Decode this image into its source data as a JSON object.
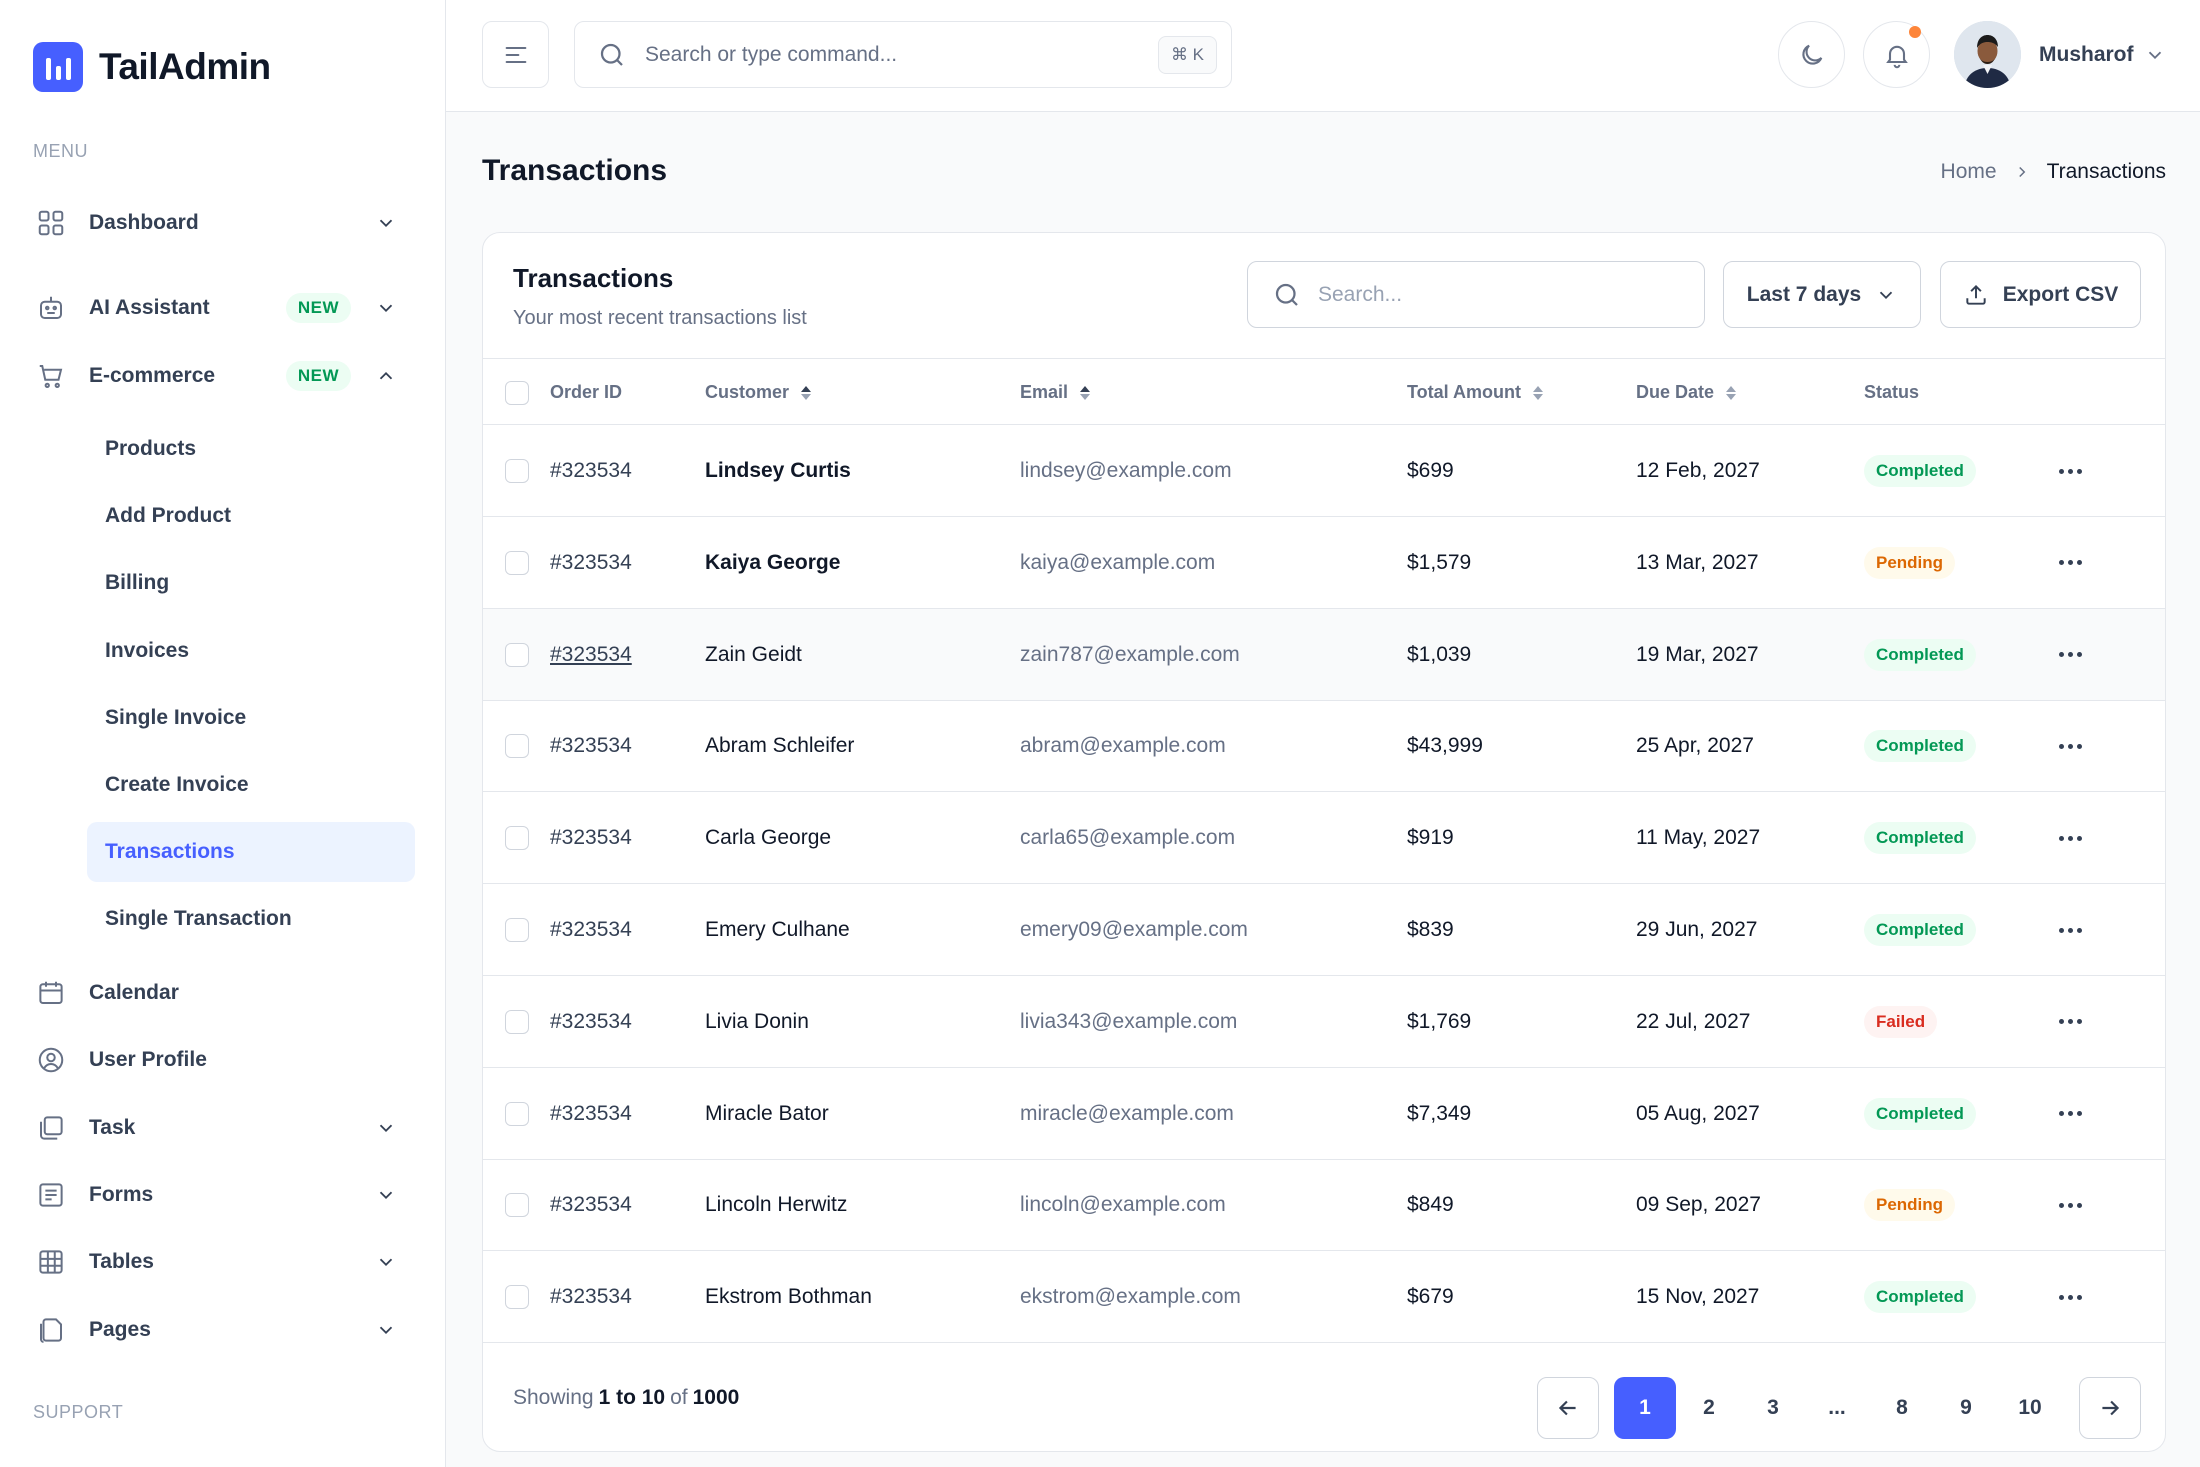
{
  "app": {
    "name": "TailAdmin"
  },
  "sidebar": {
    "menu_label": "MENU",
    "support_label": "SUPPORT",
    "items": [
      {
        "label": "Dashboard",
        "icon": "grid-icon"
      },
      {
        "label": "AI Assistant",
        "icon": "robot-icon",
        "badge": "NEW"
      },
      {
        "label": "E-commerce",
        "icon": "cart-icon",
        "badge": "NEW"
      },
      {
        "label": "Calendar",
        "icon": "calendar-icon"
      },
      {
        "label": "User Profile",
        "icon": "user-circle-icon"
      },
      {
        "label": "Task",
        "icon": "task-icon"
      },
      {
        "label": "Forms",
        "icon": "form-icon"
      },
      {
        "label": "Tables",
        "icon": "table-icon"
      },
      {
        "label": "Pages",
        "icon": "pages-icon"
      }
    ],
    "ecommerce_sub": [
      "Products",
      "Add Product",
      "Billing",
      "Invoices",
      "Single Invoice",
      "Create Invoice",
      "Transactions",
      "Single Transaction"
    ],
    "active_sub": "Transactions"
  },
  "header": {
    "search_placeholder": "Search or type command...",
    "shortcut": "⌘ K",
    "user_name": "Musharof"
  },
  "page": {
    "title": "Transactions",
    "breadcrumb": {
      "home": "Home",
      "current": "Transactions"
    }
  },
  "card": {
    "title": "Transactions",
    "subtitle": "Your most recent transactions list",
    "search_placeholder": "Search...",
    "filter_label": "Last 7 days",
    "export_label": "Export CSV",
    "columns": {
      "order_id": "Order ID",
      "customer": "Customer",
      "email": "Email",
      "total": "Total Amount",
      "due": "Due Date",
      "status": "Status"
    },
    "rows": [
      {
        "order": "#323534",
        "customer": "Lindsey Curtis",
        "email": "lindsey@example.com",
        "amount": "$699",
        "due": "12 Feb, 2027",
        "status": "Completed"
      },
      {
        "order": "#323534",
        "customer": "Kaiya George",
        "email": "kaiya@example.com",
        "amount": "$1,579",
        "due": "13 Mar, 2027",
        "status": "Pending"
      },
      {
        "order": "#323534",
        "customer": "Zain Geidt",
        "email": "zain787@example.com",
        "amount": "$1,039",
        "due": "19 Mar, 2027",
        "status": "Completed"
      },
      {
        "order": "#323534",
        "customer": "Abram Schleifer",
        "email": "abram@example.com",
        "amount": "$43,999",
        "due": "25 Apr, 2027",
        "status": "Completed"
      },
      {
        "order": "#323534",
        "customer": "Carla George",
        "email": "carla65@example.com",
        "amount": "$919",
        "due": "11 May, 2027",
        "status": "Completed"
      },
      {
        "order": "#323534",
        "customer": "Emery Culhane",
        "email": "emery09@example.com",
        "amount": "$839",
        "due": "29 Jun, 2027",
        "status": "Completed"
      },
      {
        "order": "#323534",
        "customer": "Livia Donin",
        "email": "livia343@example.com",
        "amount": "$1,769",
        "due": "22 Jul, 2027",
        "status": "Failed"
      },
      {
        "order": "#323534",
        "customer": "Miracle Bator",
        "email": "miracle@example.com",
        "amount": "$7,349",
        "due": "05 Aug, 2027",
        "status": "Completed"
      },
      {
        "order": "#323534",
        "customer": "Lincoln Herwitz",
        "email": "lincoln@example.com",
        "amount": "$849",
        "due": "09 Sep, 2027",
        "status": "Pending"
      },
      {
        "order": "#323534",
        "customer": "Ekstrom Bothman",
        "email": "ekstrom@example.com",
        "amount": "$679",
        "due": "15 Nov, 2027",
        "status": "Completed"
      }
    ],
    "footer": {
      "showing_prefix": "Showing",
      "showing_range": "1 to 10",
      "of": "of",
      "total": "1000",
      "pages": [
        "1",
        "2",
        "3",
        "...",
        "8",
        "9",
        "10"
      ],
      "current_page": "1"
    }
  },
  "colors": {
    "brand": "#465fff",
    "success": "#039855",
    "warning": "#dc6803",
    "error": "#d92d20",
    "notification": "#fd853a"
  }
}
